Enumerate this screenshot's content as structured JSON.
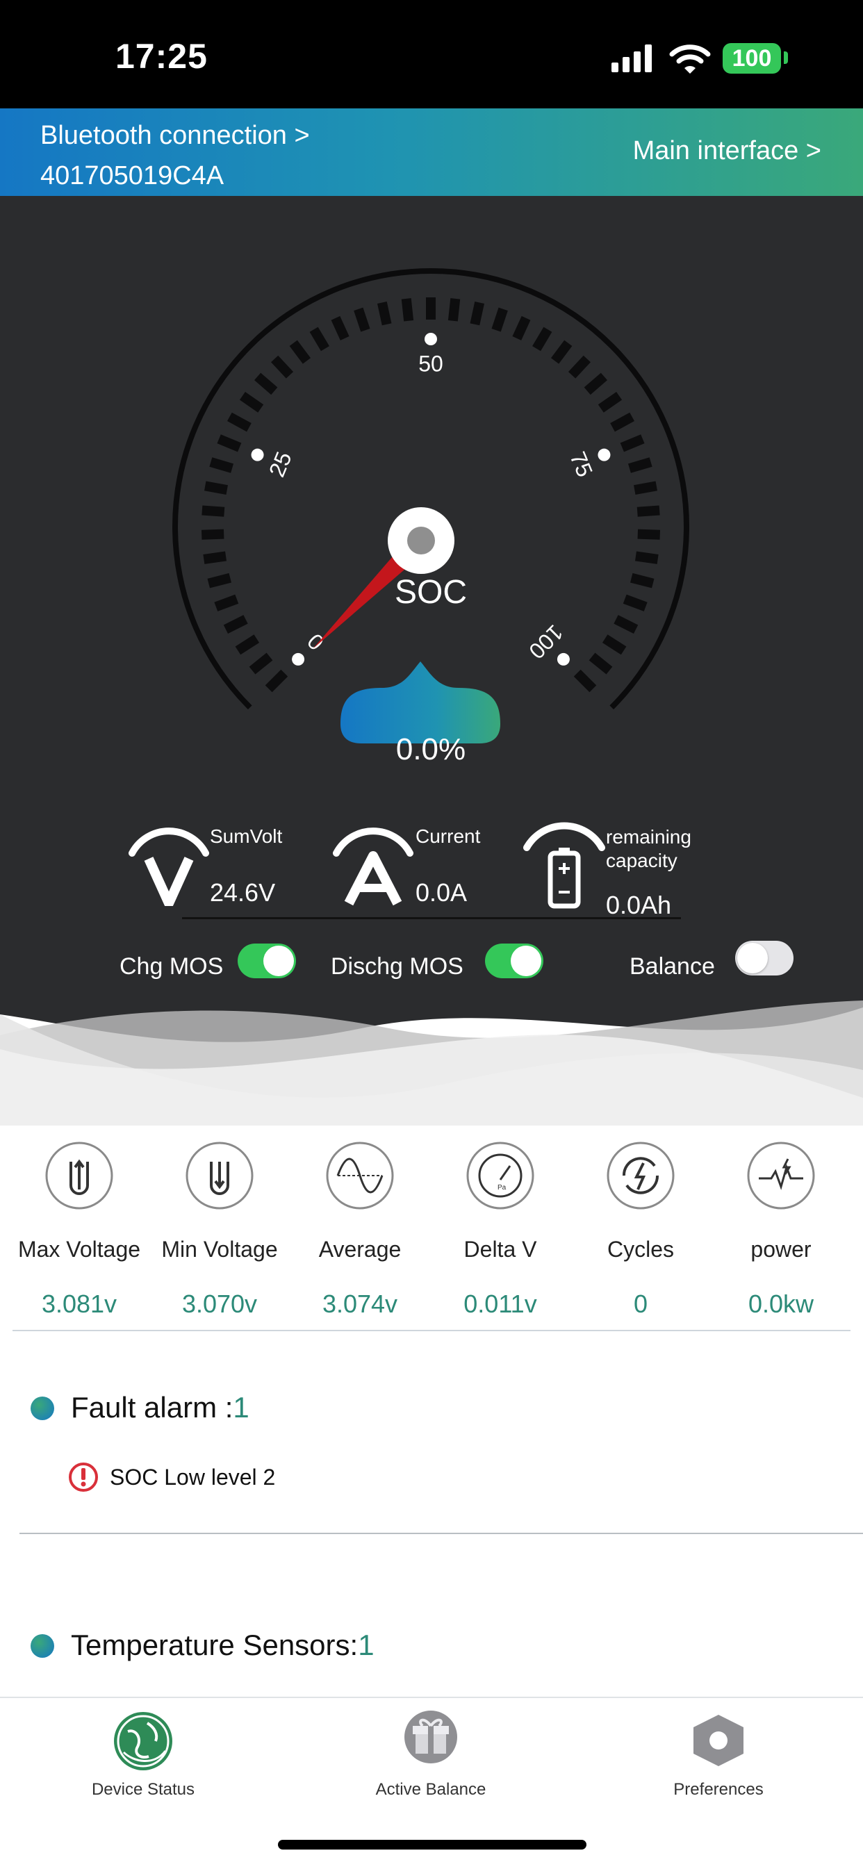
{
  "status_bar": {
    "time": "17:25",
    "battery": "100"
  },
  "header": {
    "bluetooth_label": "Bluetooth connection >",
    "device_id": "401705019C4A",
    "main_link": "Main interface >"
  },
  "gauge": {
    "label": "SOC",
    "ticks": [
      "0",
      "25",
      "50",
      "75",
      "100"
    ],
    "soc_value": "0.0%",
    "soc_fraction": 0.0
  },
  "metrics": {
    "sum_volt": {
      "label": "SumVolt",
      "value": "24.6V"
    },
    "current": {
      "label": "Current",
      "value": "0.0A"
    },
    "capacity": {
      "label_line1": "remaining",
      "label_line2": "capacity",
      "value": "0.0Ah"
    }
  },
  "switches": {
    "chg": {
      "label": "Chg MOS",
      "on": true
    },
    "dischg": {
      "label": "Dischg MOS",
      "on": true
    },
    "balance": {
      "label": "Balance",
      "on": false
    }
  },
  "stats": [
    {
      "label": "Max Voltage",
      "value": "3.081v",
      "icon": "max-voltage-icon"
    },
    {
      "label": "Min Voltage",
      "value": "3.070v",
      "icon": "min-voltage-icon"
    },
    {
      "label": "Average",
      "value": "3.074v",
      "icon": "average-wave-icon"
    },
    {
      "label": "Delta V",
      "value": "0.011v",
      "icon": "pressure-gauge-icon"
    },
    {
      "label": "Cycles",
      "value": "0",
      "icon": "cycles-icon"
    },
    {
      "label": "power",
      "value": "0.0kw",
      "icon": "power-icon"
    }
  ],
  "fault": {
    "title": "Fault alarm :",
    "count": "1",
    "items": [
      "SOC Low level 2"
    ]
  },
  "temperature": {
    "title": "Temperature Sensors:",
    "count": "1"
  },
  "tabs": [
    {
      "label": "Device Status",
      "icon": "globe-icon"
    },
    {
      "label": "Active Balance",
      "icon": "gift-icon"
    },
    {
      "label": "Preferences",
      "icon": "hexagon-settings-icon"
    }
  ],
  "colors": {
    "accent_green": "#34c759",
    "value_teal": "#2c8a78",
    "header_blue": "#1577c4",
    "header_green": "#3aa87a",
    "needle_red": "#c4161c",
    "alarm_red": "#d9303a"
  }
}
